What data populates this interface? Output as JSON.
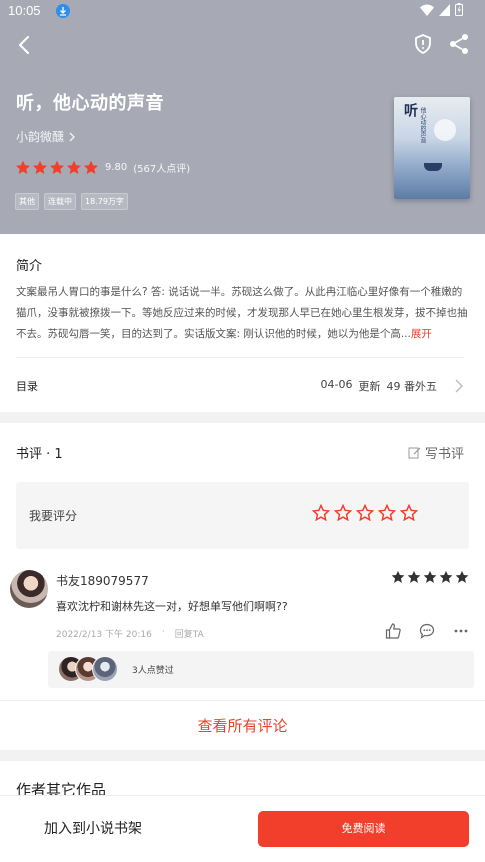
{
  "status_bar": {
    "time": "10:05"
  },
  "book": {
    "title": "听，他心动的声音",
    "author": "小韵微醺",
    "score": "9.80",
    "rating_count": "(567人点评)",
    "tags": [
      "其他",
      "连载中",
      "18.79万字"
    ],
    "cover": {
      "title": "听",
      "subtitle": "他心动的声音"
    }
  },
  "intro": {
    "heading": "简介",
    "text": "文案最吊人胃口的事是什么? 答: 说话说一半。苏砚这么做了。从此冉江临心里好像有一个稚嫩的猫爪，没事就被撩拨一下。等她反应过来的时候，才发现那人早已在她心里生根发芽，拔不掉也抽不去。苏砚勾唇一笑，目的达到了。实话版文案: 刚认识他的时候，她以为他是个高...",
    "more": "展开",
    "toc_label": "目录",
    "latest_date": "04-06",
    "latest_prefix": "更新",
    "latest_chapter": "49 番外五"
  },
  "reviews": {
    "heading": "书评 · 1",
    "write_label": "写书评",
    "my_rating_label": "我要评分",
    "comment": {
      "user": "书友189079577",
      "stars": 5,
      "text": "喜欢沈柠和谢林先这一对，好想单写他们啊啊??",
      "date": "2022/2/13 下午 20:16",
      "separator": "·",
      "reply": "回复TA",
      "likes_text": "3人点赞过"
    },
    "view_all": "查看所有评论"
  },
  "other_works": {
    "heading": "作者其它作品"
  },
  "bottom": {
    "add_shelf": "加入到小说书架",
    "read": "免费阅读"
  },
  "colors": {
    "accent": "#e8432d",
    "header_bg": "#a7aab5",
    "button": "#f13f2c"
  }
}
